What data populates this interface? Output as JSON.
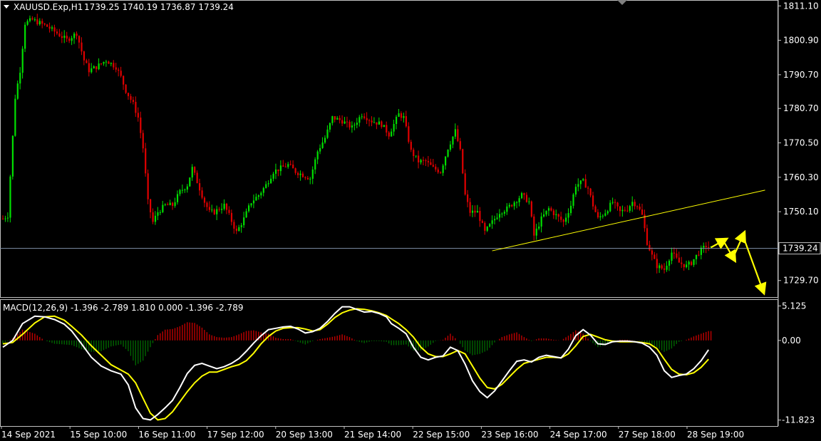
{
  "header": {
    "symbol": "XAUUSD.Exp,H1",
    "ohlc": "1739.25 1740.19 1736.87 1739.24"
  },
  "current_price_label": "1739.24",
  "colors": {
    "background": "#000000",
    "bull": "#00e000",
    "bear": "#e00000",
    "trendline": "#ffff00",
    "macd_line": "#ffffff",
    "signal_line": "#ffff00",
    "hist_pos": "#c00000",
    "hist_neg": "#006400",
    "grid": "#c0c0c0"
  },
  "macd_header": "MACD(12,26,9) -1.396 -2.789 1.810 0.000 -1.396 -2.789",
  "chart_data": [
    {
      "type": "line",
      "title": "XAUUSD.Exp,H1",
      "y_ticks": [
        "1811.10",
        "1800.90",
        "1790.70",
        "1780.70",
        "1770.50",
        "1760.30",
        "1750.10",
        "1729.70"
      ],
      "ylim": [
        1725.0,
        1812.0
      ],
      "current_price": 1739.24,
      "x_ticks": [
        "14 Sep 2021",
        "15 Sep 10:00",
        "16 Sep 11:00",
        "17 Sep 12:00",
        "20 Sep 13:00",
        "21 Sep 14:00",
        "22 Sep 15:00",
        "23 Sep 16:00",
        "24 Sep 17:00",
        "27 Sep 18:00",
        "28 Sep 19:00"
      ],
      "price_path": [
        [
          0,
          1748
        ],
        [
          2,
          1749
        ],
        [
          5,
          1784
        ],
        [
          7,
          1792
        ],
        [
          9,
          1806
        ],
        [
          12,
          1807
        ],
        [
          18,
          1805
        ],
        [
          22,
          1803
        ],
        [
          26,
          1801
        ],
        [
          30,
          1803
        ],
        [
          33,
          1795
        ],
        [
          35,
          1792
        ],
        [
          38,
          1793
        ],
        [
          42,
          1795
        ],
        [
          46,
          1793
        ],
        [
          48,
          1790
        ],
        [
          50,
          1786
        ],
        [
          53,
          1782
        ],
        [
          55,
          1778
        ],
        [
          57,
          1769
        ],
        [
          59,
          1753
        ],
        [
          61,
          1747
        ],
        [
          63,
          1750
        ],
        [
          66,
          1752
        ],
        [
          69,
          1752
        ],
        [
          72,
          1756
        ],
        [
          75,
          1758
        ],
        [
          77,
          1763
        ],
        [
          79,
          1759
        ],
        [
          82,
          1753
        ],
        [
          84,
          1750
        ],
        [
          86,
          1750
        ],
        [
          90,
          1752
        ],
        [
          92,
          1749
        ],
        [
          95,
          1744
        ],
        [
          98,
          1748
        ],
        [
          101,
          1753
        ],
        [
          104,
          1755
        ],
        [
          107,
          1758
        ],
        [
          110,
          1762
        ],
        [
          113,
          1763
        ],
        [
          116,
          1764
        ],
        [
          119,
          1762
        ],
        [
          122,
          1761
        ],
        [
          125,
          1760
        ],
        [
          128,
          1768
        ],
        [
          131,
          1772
        ],
        [
          134,
          1778
        ],
        [
          138,
          1777
        ],
        [
          142,
          1775
        ],
        [
          146,
          1779
        ],
        [
          150,
          1777
        ],
        [
          154,
          1776
        ],
        [
          157,
          1773
        ],
        [
          159,
          1776
        ],
        [
          161,
          1779
        ],
        [
          163,
          1778
        ],
        [
          166,
          1768
        ],
        [
          169,
          1765
        ],
        [
          172,
          1765
        ],
        [
          175,
          1763
        ],
        [
          178,
          1762
        ],
        [
          181,
          1769
        ],
        [
          184,
          1774
        ],
        [
          186,
          1768
        ],
        [
          188,
          1755
        ],
        [
          190,
          1750
        ],
        [
          193,
          1750
        ],
        [
          196,
          1744
        ],
        [
          199,
          1747
        ],
        [
          202,
          1750
        ],
        [
          205,
          1751
        ],
        [
          208,
          1753
        ],
        [
          211,
          1755
        ],
        [
          214,
          1753
        ],
        [
          216,
          1743
        ],
        [
          219,
          1748
        ],
        [
          222,
          1751
        ],
        [
          225,
          1749
        ],
        [
          228,
          1747
        ],
        [
          231,
          1752
        ],
        [
          233,
          1758
        ],
        [
          236,
          1759
        ],
        [
          238,
          1757
        ],
        [
          240,
          1752
        ],
        [
          242,
          1748
        ],
        [
          245,
          1750
        ],
        [
          248,
          1753
        ],
        [
          251,
          1750
        ],
        [
          254,
          1751
        ],
        [
          256,
          1753
        ],
        [
          258,
          1752
        ],
        [
          260,
          1749
        ],
        [
          262,
          1741
        ],
        [
          264,
          1737
        ],
        [
          266,
          1734
        ],
        [
          269,
          1733
        ],
        [
          272,
          1738
        ],
        [
          275,
          1735
        ],
        [
          278,
          1734
        ],
        [
          280,
          1735
        ],
        [
          283,
          1738
        ],
        [
          286,
          1740
        ],
        [
          288,
          1739.24
        ]
      ],
      "trendline": {
        "x": [
          199,
          310
        ],
        "y": [
          1738.5,
          1756.5
        ]
      },
      "projection": [
        [
          288,
          1739.5
        ],
        [
          293,
          1741.5
        ],
        [
          297,
          1736.5
        ],
        [
          301,
          1743.0
        ],
        [
          309,
          1727.0
        ]
      ]
    },
    {
      "type": "line",
      "title": "MACD(12,26,9)",
      "y_ticks": [
        "5.125",
        "0.00",
        "-11.823"
      ],
      "ylim": [
        -12.5,
        5.8
      ],
      "series": [
        {
          "role": "main",
          "values": [
            [
              0,
              -1.0
            ],
            [
              4,
              0.0
            ],
            [
              8,
              2.5
            ],
            [
              13,
              3.6
            ],
            [
              17,
              3.5
            ],
            [
              21,
              3.1
            ],
            [
              25,
              2.4
            ],
            [
              28,
              1.4
            ],
            [
              32,
              -0.5
            ],
            [
              36,
              -2.5
            ],
            [
              40,
              -3.8
            ],
            [
              44,
              -4.5
            ],
            [
              48,
              -5.0
            ],
            [
              51,
              -6.6
            ],
            [
              54,
              -10.0
            ],
            [
              57,
              -11.6
            ],
            [
              60,
              -11.8
            ],
            [
              63,
              -11.0
            ],
            [
              66,
              -10.0
            ],
            [
              69,
              -8.9
            ],
            [
              72,
              -7.0
            ],
            [
              75,
              -4.9
            ],
            [
              78,
              -3.7
            ],
            [
              81,
              -3.4
            ],
            [
              84,
              -3.8
            ],
            [
              87,
              -4.2
            ],
            [
              90,
              -3.9
            ],
            [
              93,
              -3.4
            ],
            [
              96,
              -2.7
            ],
            [
              99,
              -1.6
            ],
            [
              102,
              -0.4
            ],
            [
              105,
              0.7
            ],
            [
              108,
              1.6
            ],
            [
              111,
              1.8
            ],
            [
              114,
              2.0
            ],
            [
              117,
              2.1
            ],
            [
              120,
              1.7
            ],
            [
              123,
              1.1
            ],
            [
              126,
              1.3
            ],
            [
              129,
              1.8
            ],
            [
              132,
              2.8
            ],
            [
              135,
              4.0
            ],
            [
              138,
              5.0
            ],
            [
              141,
              5.0
            ],
            [
              144,
              4.6
            ],
            [
              147,
              4.2
            ],
            [
              150,
              4.3
            ],
            [
              153,
              4.0
            ],
            [
              156,
              3.5
            ],
            [
              158,
              2.5
            ],
            [
              161,
              1.8
            ],
            [
              164,
              1.0
            ],
            [
              167,
              -1.0
            ],
            [
              170,
              -2.5
            ],
            [
              173,
              -2.9
            ],
            [
              176,
              -2.5
            ],
            [
              179,
              -2.3
            ],
            [
              182,
              -1.0
            ],
            [
              185,
              -1.5
            ],
            [
              188,
              -3.5
            ],
            [
              191,
              -6.0
            ],
            [
              194,
              -7.6
            ],
            [
              197,
              -8.5
            ],
            [
              200,
              -7.5
            ],
            [
              203,
              -6.0
            ],
            [
              206,
              -4.5
            ],
            [
              209,
              -3.1
            ],
            [
              212,
              -2.9
            ],
            [
              215,
              -3.2
            ],
            [
              218,
              -2.5
            ],
            [
              221,
              -2.2
            ],
            [
              224,
              -2.4
            ],
            [
              227,
              -2.6
            ],
            [
              230,
              -1.3
            ],
            [
              233,
              0.7
            ],
            [
              236,
              1.6
            ],
            [
              239,
              0.8
            ],
            [
              242,
              -0.5
            ],
            [
              245,
              -0.6
            ],
            [
              248,
              -0.2
            ],
            [
              251,
              -0.1
            ],
            [
              254,
              -0.1
            ],
            [
              257,
              -0.2
            ],
            [
              260,
              -0.4
            ],
            [
              263,
              -1.0
            ],
            [
              266,
              -2.2
            ],
            [
              269,
              -4.5
            ],
            [
              272,
              -5.5
            ],
            [
              275,
              -5.2
            ],
            [
              278,
              -5.0
            ],
            [
              281,
              -4.2
            ],
            [
              284,
              -3.0
            ],
            [
              287,
              -1.396
            ]
          ]
        },
        {
          "role": "signal",
          "values": [
            [
              0,
              -0.5
            ],
            [
              4,
              -0.3
            ],
            [
              8,
              0.9
            ],
            [
              13,
              2.6
            ],
            [
              17,
              3.5
            ],
            [
              21,
              3.6
            ],
            [
              25,
              3.0
            ],
            [
              28,
              2.1
            ],
            [
              32,
              0.8
            ],
            [
              36,
              -0.8
            ],
            [
              40,
              -2.2
            ],
            [
              44,
              -3.6
            ],
            [
              48,
              -4.4
            ],
            [
              51,
              -5.0
            ],
            [
              54,
              -6.3
            ],
            [
              57,
              -8.6
            ],
            [
              60,
              -10.8
            ],
            [
              63,
              -11.8
            ],
            [
              66,
              -11.6
            ],
            [
              69,
              -10.6
            ],
            [
              72,
              -9.1
            ],
            [
              75,
              -7.6
            ],
            [
              78,
              -6.3
            ],
            [
              81,
              -5.3
            ],
            [
              84,
              -4.7
            ],
            [
              87,
              -4.7
            ],
            [
              90,
              -4.3
            ],
            [
              93,
              -3.9
            ],
            [
              96,
              -3.6
            ],
            [
              99,
              -3.0
            ],
            [
              102,
              -1.9
            ],
            [
              105,
              -0.5
            ],
            [
              108,
              0.6
            ],
            [
              111,
              1.4
            ],
            [
              114,
              1.8
            ],
            [
              117,
              1.9
            ],
            [
              120,
              1.9
            ],
            [
              123,
              1.7
            ],
            [
              126,
              1.4
            ],
            [
              129,
              1.6
            ],
            [
              132,
              2.4
            ],
            [
              135,
              3.4
            ],
            [
              138,
              4.1
            ],
            [
              141,
              4.5
            ],
            [
              144,
              4.7
            ],
            [
              147,
              4.6
            ],
            [
              150,
              4.4
            ],
            [
              153,
              4.1
            ],
            [
              156,
              3.7
            ],
            [
              158,
              3.2
            ],
            [
              161,
              2.5
            ],
            [
              164,
              1.6
            ],
            [
              167,
              0.5
            ],
            [
              170,
              -1.0
            ],
            [
              173,
              -2.0
            ],
            [
              176,
              -2.4
            ],
            [
              179,
              -2.4
            ],
            [
              182,
              -2.0
            ],
            [
              185,
              -1.5
            ],
            [
              188,
              -2.0
            ],
            [
              191,
              -3.8
            ],
            [
              194,
              -5.6
            ],
            [
              197,
              -7.0
            ],
            [
              200,
              -7.2
            ],
            [
              203,
              -6.5
            ],
            [
              206,
              -5.4
            ],
            [
              209,
              -4.3
            ],
            [
              212,
              -3.4
            ],
            [
              215,
              -3.1
            ],
            [
              218,
              -2.8
            ],
            [
              221,
              -2.5
            ],
            [
              224,
              -2.5
            ],
            [
              227,
              -2.6
            ],
            [
              230,
              -2.0
            ],
            [
              233,
              -0.8
            ],
            [
              236,
              0.6
            ],
            [
              239,
              0.9
            ],
            [
              242,
              0.5
            ],
            [
              245,
              0.1
            ],
            [
              248,
              -0.1
            ],
            [
              251,
              -0.2
            ],
            [
              254,
              -0.2
            ],
            [
              257,
              -0.2
            ],
            [
              260,
              -0.3
            ],
            [
              263,
              -0.5
            ],
            [
              266,
              -1.2
            ],
            [
              269,
              -2.8
            ],
            [
              272,
              -4.3
            ],
            [
              275,
              -5.0
            ],
            [
              278,
              -5.1
            ],
            [
              281,
              -4.8
            ],
            [
              284,
              -4.0
            ],
            [
              287,
              -2.789
            ]
          ]
        }
      ]
    }
  ]
}
